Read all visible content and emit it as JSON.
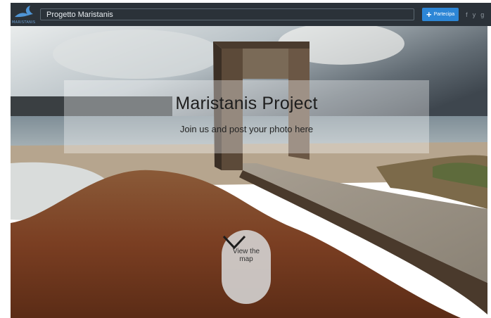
{
  "header": {
    "logo_text": "MARISTANIS",
    "site_title": "Progetto Maristanis",
    "add_button_label": "Partecipa",
    "social": [
      "f",
      "y",
      "g"
    ]
  },
  "hero": {
    "title": "Maristanis Project",
    "subtitle": "Join us and post your photo here",
    "map_button_label": "View the map"
  },
  "colors": {
    "topbar": "#2b3239",
    "accent": "#2d86d6"
  }
}
